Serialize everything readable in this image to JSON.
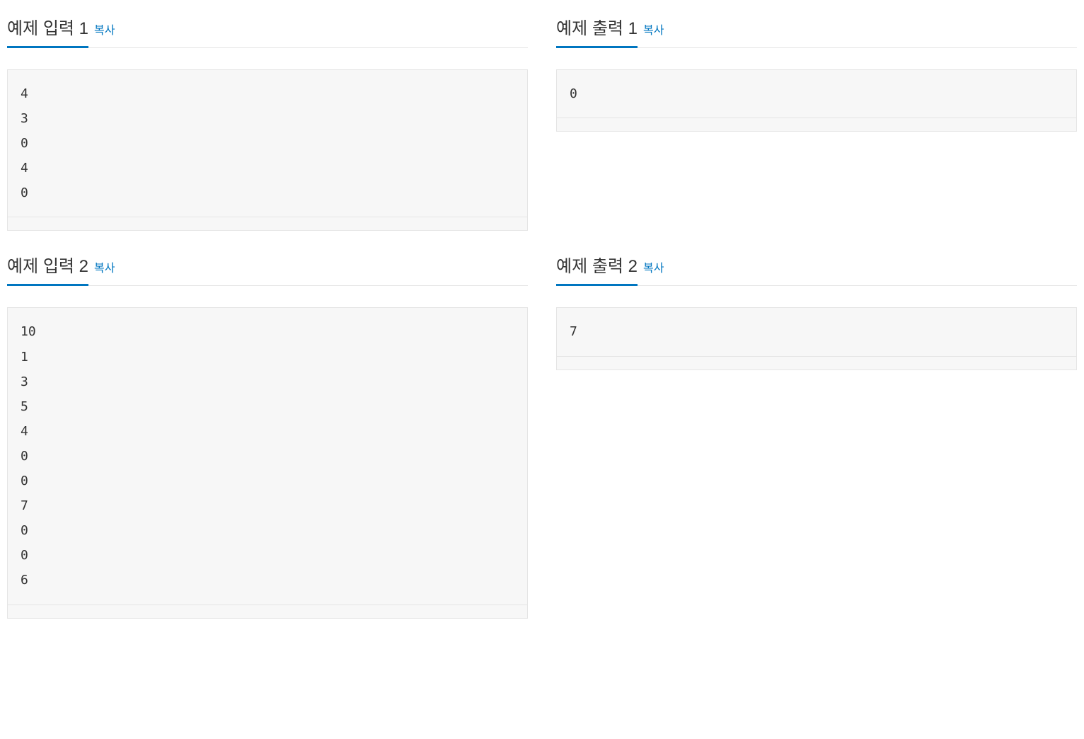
{
  "copy_label": "복사",
  "examples": [
    {
      "input_title": "예제 입력 1",
      "output_title": "예제 출력 1",
      "input": "4\n3\n0\n4\n0",
      "output": "0"
    },
    {
      "input_title": "예제 입력 2",
      "output_title": "예제 출력 2",
      "input": "10\n1\n3\n5\n4\n0\n0\n7\n0\n0\n6",
      "output": "7"
    }
  ]
}
